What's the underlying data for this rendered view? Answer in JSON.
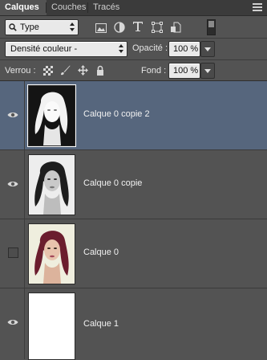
{
  "tabs": [
    "Calques",
    "Couches",
    "Tracés"
  ],
  "filter": {
    "type_label": "Type"
  },
  "blend": {
    "mode": "Densité couleur -",
    "opacity_label": "Opacité :",
    "opacity_value": "100 %"
  },
  "lock": {
    "label": "Verrou :",
    "fill_label": "Fond :",
    "fill_value": "100 %"
  },
  "layers": [
    {
      "name": "Calque 0 copie 2",
      "visible": true,
      "selected": true
    },
    {
      "name": "Calque 0 copie",
      "visible": true,
      "selected": false
    },
    {
      "name": "Calque 0",
      "visible": false,
      "selected": false
    },
    {
      "name": "Calque 1",
      "visible": true,
      "selected": false
    }
  ],
  "colors": {
    "panel": "#535353",
    "selected_row": "#56667d",
    "tab_bar": "#3b3b3b"
  }
}
